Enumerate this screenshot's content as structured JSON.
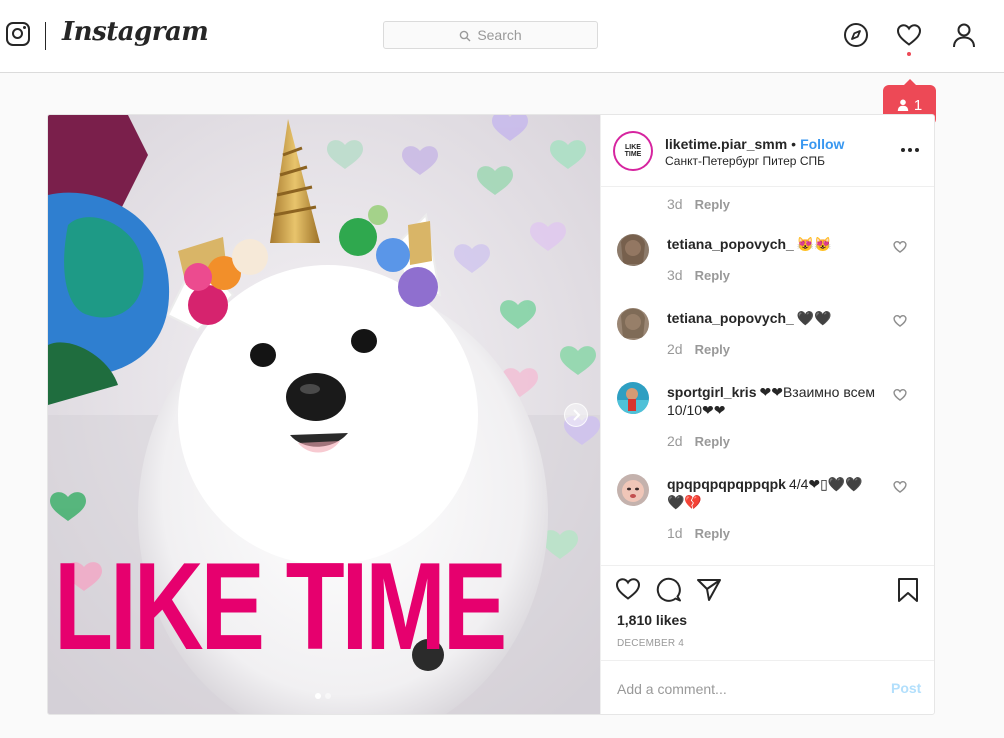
{
  "header": {
    "logo_text": "Instagram",
    "search_placeholder": "Search",
    "notification_count": "1",
    "colors": {
      "alert": "#ed4956",
      "link": "#3897f0"
    }
  },
  "post": {
    "username": "liketime.piar_smm",
    "separator": "•",
    "follow_label": "Follow",
    "location": "Санкт-Петербург Питер СПБ",
    "avatar_text": "LIKE TIME",
    "image_caption_text": "LIKE TIME",
    "top_meta": {
      "time": "3d",
      "reply": "Reply"
    },
    "comments": [
      {
        "user": "tetiana_popovych_",
        "text": "😻😻",
        "time": "3d",
        "reply": "Reply"
      },
      {
        "user": "tetiana_popovych_",
        "text": "🖤🖤",
        "time": "2d",
        "reply": "Reply"
      },
      {
        "user": "sportgirl_kris",
        "text": "❤❤Взаимно всем 10/10❤❤",
        "time": "2d",
        "reply": "Reply"
      },
      {
        "user": "qpqpqpqpqppqpk",
        "text": "4/4❤▯🖤🖤🖤💔",
        "time": "1d",
        "reply": "Reply"
      }
    ],
    "likes": "1,810 likes",
    "date": "DECEMBER 4",
    "comment_placeholder": "Add a comment...",
    "post_button": "Post"
  }
}
